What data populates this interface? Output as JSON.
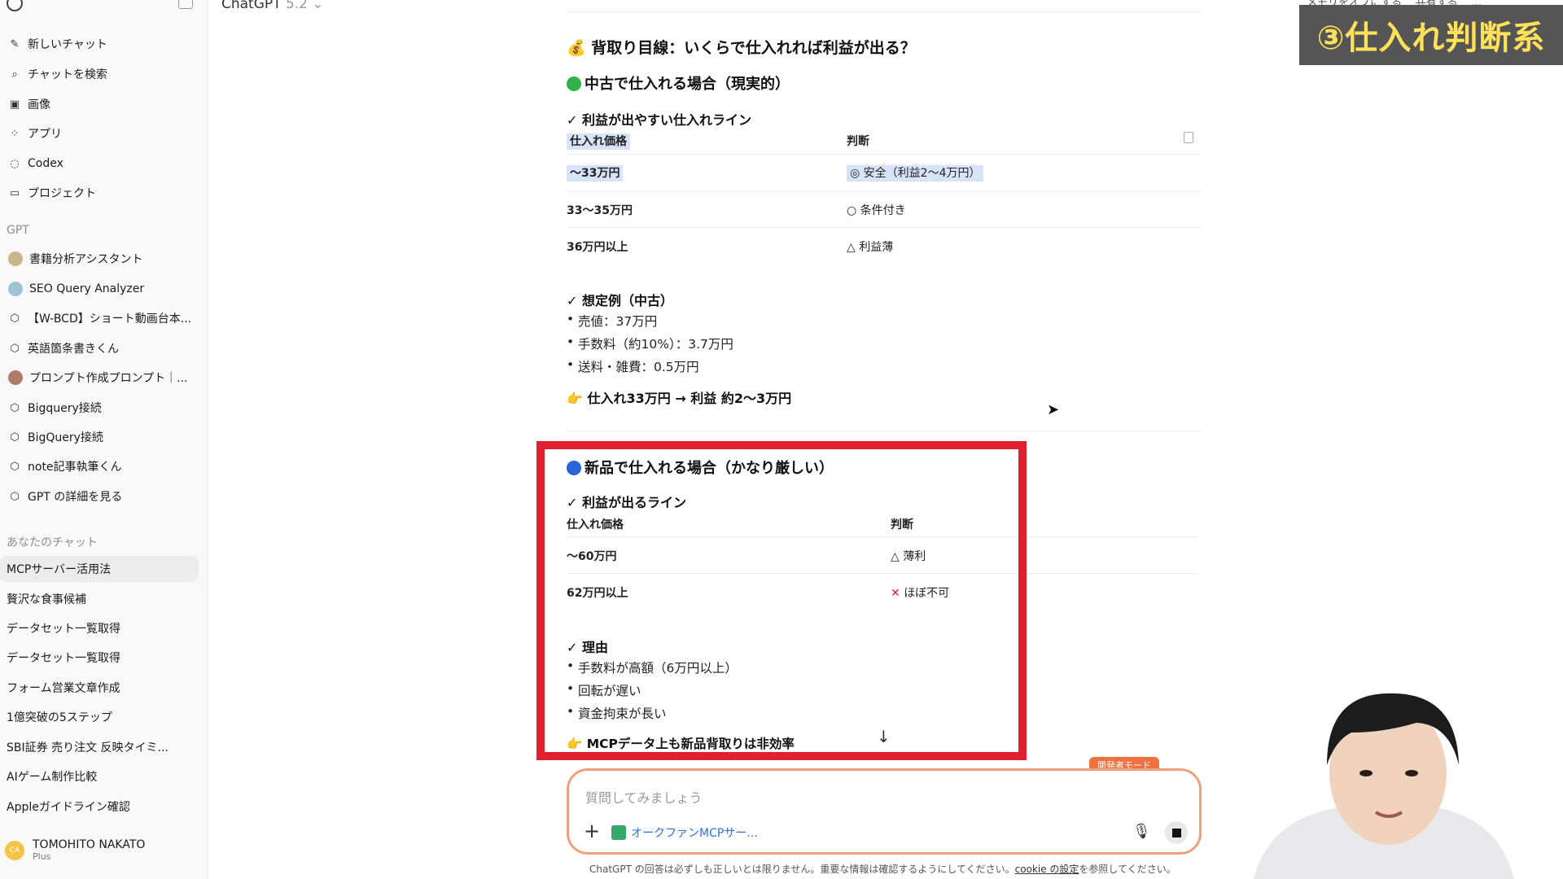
{
  "app": {
    "model_name": "ChatGPT",
    "model_version": "5.2"
  },
  "topbar": {
    "memory_off": "メモリをオフにする",
    "share": "共有する",
    "more": "…"
  },
  "overlay_title": "③仕入れ判断系",
  "sidebar": {
    "nav": [
      {
        "label": "新しいチャット",
        "icon": "edit-icon"
      },
      {
        "label": "チャットを検索",
        "icon": "search-icon"
      },
      {
        "label": "画像",
        "icon": "image-icon"
      },
      {
        "label": "アプリ",
        "icon": "apps-icon"
      },
      {
        "label": "Codex",
        "icon": "codex-icon"
      },
      {
        "label": "プロジェクト",
        "icon": "folder-icon"
      }
    ],
    "gpt_section": "GPT",
    "gpts": [
      {
        "label": "書籍分析アシスタント"
      },
      {
        "label": "SEO Query Analyzer"
      },
      {
        "label": "【W-BCD】ショート動画台本..."
      },
      {
        "label": "英語箇条書きくん"
      },
      {
        "label": "プロンプト作成プロンプト｜..."
      },
      {
        "label": "Bigquery接続"
      },
      {
        "label": "BigQuery接続"
      },
      {
        "label": "note記事執筆くん"
      },
      {
        "label": "GPT の詳細を見る"
      }
    ],
    "chats_section": "あなたのチャット",
    "chats": [
      {
        "label": "MCPサーバー活用法"
      },
      {
        "label": "贅沢な食事候補"
      },
      {
        "label": "データセット一覧取得"
      },
      {
        "label": "データセット一覧取得"
      },
      {
        "label": "フォーム営業文章作成"
      },
      {
        "label": "1億突破の5ステップ"
      },
      {
        "label": "SBI証券 売り注文 反映タイミ..."
      },
      {
        "label": "AIゲーム制作比較"
      },
      {
        "label": "Appleガイドライン確認"
      }
    ],
    "user": {
      "initials": "CA",
      "name": "TOMOHITO NAKATO",
      "plan": "Plus"
    }
  },
  "content": {
    "title": "💰 背取り目線：いくらで仕入れれば利益が出る？",
    "used": {
      "heading": "中古で仕入れる場合（現実的）",
      "sub": "✓ 利益が出やすい仕入れライン",
      "col1": "仕入れ価格",
      "col2": "判断",
      "rows": [
        {
          "price": "〜33万円",
          "judge": "◎ 安全（利益2〜4万円）"
        },
        {
          "price": "33〜35万円",
          "judge": "○ 条件付き"
        },
        {
          "price": "36万円以上",
          "judge": "△ 利益薄"
        }
      ],
      "example_heading": "✓ 想定例（中古）",
      "bullets": [
        "売値：37万円",
        "手数料（約10%）：3.7万円",
        "送料・雑費：0.5万円"
      ],
      "conclusion": "👉 仕入れ33万円 → 利益 約2〜3万円"
    },
    "new": {
      "heading": "新品で仕入れる場合（かなり厳しい）",
      "sub": "✓ 利益が出るライン",
      "col1": "仕入れ価格",
      "col2": "判断",
      "rows": [
        {
          "price": "〜60万円",
          "judge": "△ 薄利"
        },
        {
          "price": "62万円以上",
          "judge": "ほぼ不可"
        }
      ],
      "reason_heading": "✓ 理由",
      "bullets": [
        "手数料が高額（6万円以上）",
        "回転が遅い",
        "資金拘束が長い"
      ],
      "conclusion": "👉 MCPデータ上も新品背取りは非効率"
    }
  },
  "composer": {
    "dev_mode": "開発者モード",
    "placeholder": "質問してみましょう",
    "tool": "オークファンMCPサー..."
  },
  "disclaimer": {
    "text": "ChatGPT の回答は必ずしも正しいとは限りません。重要な情報は確認するようにしてください。",
    "link": "cookie の設定",
    "suffix": "を参照してください。"
  },
  "colors": {
    "accent_red": "#e0202e",
    "overlay_bg": "#555555",
    "overlay_text": "#ffe25a",
    "composer_border": "#f0a07a",
    "green_dot": "#2fb24a",
    "blue_dot": "#2a62d8"
  }
}
